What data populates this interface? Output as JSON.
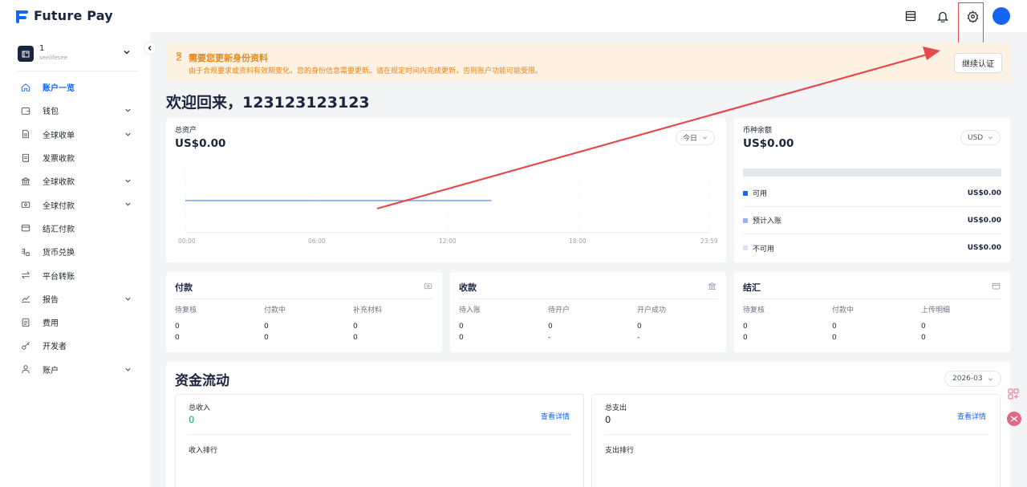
{
  "brand": {
    "name": "Future Pay",
    "accent": "#1665f0"
  },
  "header": {
    "icons": [
      "layout-icon",
      "bell-icon",
      "gear-icon",
      "avatar"
    ]
  },
  "account": {
    "name": "1",
    "sub": "seelifesee"
  },
  "sidebar": {
    "items": [
      {
        "label": "账户一览",
        "icon": "home-icon",
        "active": true,
        "expandable": false
      },
      {
        "label": "钱包",
        "icon": "wallet-icon",
        "expandable": true
      },
      {
        "label": "全球收单",
        "icon": "document-icon",
        "expandable": true
      },
      {
        "label": "发票收款",
        "icon": "invoice-icon",
        "expandable": false
      },
      {
        "label": "全球收款",
        "icon": "bank-icon",
        "expandable": true
      },
      {
        "label": "全球付款",
        "icon": "payment-icon",
        "expandable": true
      },
      {
        "label": "结汇付款",
        "icon": "card-icon",
        "expandable": false
      },
      {
        "label": "货币兑换",
        "icon": "exchange-icon",
        "expandable": false
      },
      {
        "label": "平台转账",
        "icon": "transfer-icon",
        "expandable": false
      },
      {
        "label": "报告",
        "icon": "chart-icon",
        "expandable": true
      },
      {
        "label": "费用",
        "icon": "fee-icon",
        "expandable": false
      },
      {
        "label": "开发者",
        "icon": "key-icon",
        "expandable": false
      },
      {
        "label": "账户",
        "icon": "user-icon",
        "expandable": true
      }
    ]
  },
  "banner": {
    "title": "需要您更新身份资料",
    "text": "由于合规要求或资料有效期变化，您的身份信息需要更新。请在规定时间内完成更新，否则账户功能可能受限。",
    "button": "继续认证"
  },
  "welcome": "欢迎回来，123123123123",
  "total_assets": {
    "label": "总资产",
    "value": "US$0.00",
    "period": "今日",
    "ticks": [
      "00:00",
      "06:00",
      "12:00",
      "18:00",
      "23:59"
    ]
  },
  "chart_data": {
    "type": "line",
    "x": [
      "00:00",
      "06:00",
      "12:00",
      "14:00"
    ],
    "series": [
      {
        "values": [
          0,
          0,
          0,
          0
        ]
      }
    ],
    "x_ticks": [
      "00:00",
      "06:00",
      "12:00",
      "18:00",
      "23:59"
    ],
    "grid": true,
    "color": "#5b8def"
  },
  "currency_balance": {
    "label": "币种余额",
    "value": "US$0.00",
    "currency": "USD",
    "rows": [
      {
        "name": "可用",
        "value": "US$0.00",
        "color": "#1665f0"
      },
      {
        "name": "预计入账",
        "value": "US$0.00",
        "color": "#8fb2f5"
      },
      {
        "name": "不可用",
        "value": "US$0.00",
        "color": "#d6e3fb"
      }
    ]
  },
  "payments": {
    "title": "付款",
    "icon": "payment-icon",
    "headers": [
      "待复核",
      "付款中",
      "补充材料"
    ],
    "rows": [
      [
        "0",
        "0",
        "0"
      ],
      [
        "0",
        "0",
        "0"
      ]
    ]
  },
  "collections": {
    "title": "收款",
    "icon": "bank-icon",
    "headers": [
      "待入账",
      "待开户",
      "开户成功"
    ],
    "rows": [
      [
        "0",
        "0",
        "0"
      ],
      [
        "0",
        "-",
        "-"
      ]
    ]
  },
  "settlement": {
    "title": "结汇",
    "icon": "card-icon",
    "headers": [
      "待复核",
      "付款中",
      "上传明细"
    ],
    "rows": [
      [
        "0",
        "0",
        "0"
      ],
      [
        "0",
        "0",
        "0"
      ]
    ]
  },
  "cash_flow": {
    "title": "资金流动",
    "month": "2026-03",
    "income": {
      "label": "总收入",
      "value": "0",
      "link": "查看详情",
      "ranking": "收入排行"
    },
    "expense": {
      "label": "总支出",
      "value": "0",
      "link": "查看详情",
      "ranking": "支出排行"
    }
  }
}
